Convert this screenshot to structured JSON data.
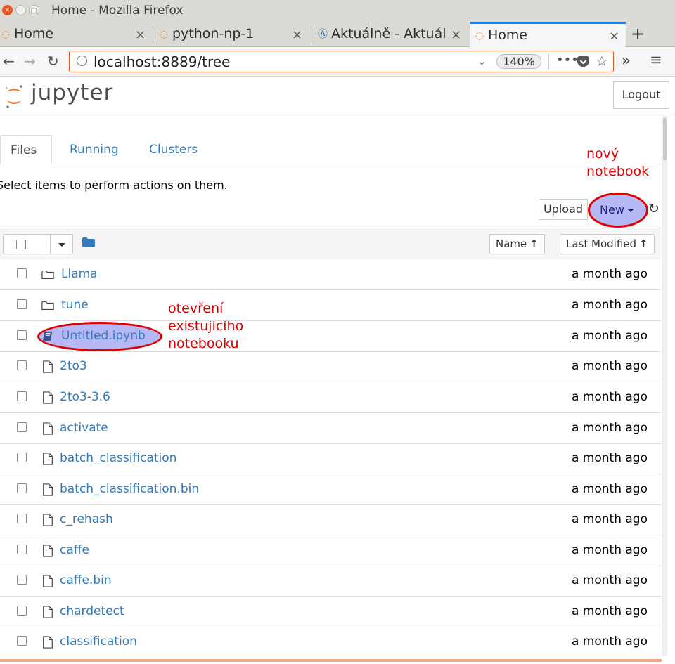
{
  "window": {
    "title": "Home - Mozilla Firefox",
    "close_glyph": "×",
    "min_glyph": "–",
    "max_glyph": "□"
  },
  "browser_tabs": [
    {
      "label": "Home",
      "icon": "jupyter-spinner-icon",
      "active": false
    },
    {
      "label": "python-np-1",
      "icon": "jupyter-spinner-icon",
      "active": false
    },
    {
      "label": "Aktuálně - Aktuál",
      "icon": "aktualne-icon",
      "active": false
    },
    {
      "label": "Home",
      "icon": "jupyter-spinner-icon",
      "active": true
    }
  ],
  "tab_close_glyph": "×",
  "new_tab_glyph": "+",
  "nav": {
    "back_glyph": "←",
    "forward_glyph": "→",
    "reload_glyph": "↻",
    "url": "localhost:8889/tree",
    "zoom": "140%",
    "more_glyph": "•••",
    "star_glyph": "☆",
    "overflow_glyph": "»",
    "menu_glyph": "≡",
    "dropdown_glyph": "⌄",
    "info_glyph": "i"
  },
  "jupyter": {
    "wordmark": "jupyter",
    "logout_label": "Logout",
    "tabs": [
      {
        "label": "Files",
        "active": true
      },
      {
        "label": "Running",
        "active": false
      },
      {
        "label": "Clusters",
        "active": false
      }
    ],
    "hint": "Select items to perform actions on them.",
    "upload_label": "Upload",
    "new_label": "New",
    "refresh_glyph": "↻",
    "sort_name_label": "Name",
    "sort_modified_label": "Last Modified",
    "sort_arrow": "↑"
  },
  "annotations": {
    "new_notebook": [
      "nový",
      "notebook"
    ],
    "open_existing": [
      "otevření",
      "existujícího",
      "notebooku"
    ]
  },
  "colors": {
    "link": "#337ab7",
    "annotation": "#e00000",
    "highlight_fill": "#b6b8f5",
    "jupyter_orange": "#f37726",
    "firefox_accent": "#0a84ff"
  },
  "files": [
    {
      "name": "Llama",
      "type": "folder",
      "modified": "a month ago"
    },
    {
      "name": "tune",
      "type": "folder",
      "modified": "a month ago"
    },
    {
      "name": "Untitled.ipynb",
      "type": "notebook",
      "modified": "a month ago"
    },
    {
      "name": "2to3",
      "type": "file",
      "modified": "a month ago"
    },
    {
      "name": "2to3-3.6",
      "type": "file",
      "modified": "a month ago"
    },
    {
      "name": "activate",
      "type": "file",
      "modified": "a month ago"
    },
    {
      "name": "batch_classification",
      "type": "file",
      "modified": "a month ago"
    },
    {
      "name": "batch_classification.bin",
      "type": "file",
      "modified": "a month ago"
    },
    {
      "name": "c_rehash",
      "type": "file",
      "modified": "a month ago"
    },
    {
      "name": "caffe",
      "type": "file",
      "modified": "a month ago"
    },
    {
      "name": "caffe.bin",
      "type": "file",
      "modified": "a month ago"
    },
    {
      "name": "chardetect",
      "type": "file",
      "modified": "a month ago"
    },
    {
      "name": "classification",
      "type": "file",
      "modified": "a month ago"
    }
  ]
}
